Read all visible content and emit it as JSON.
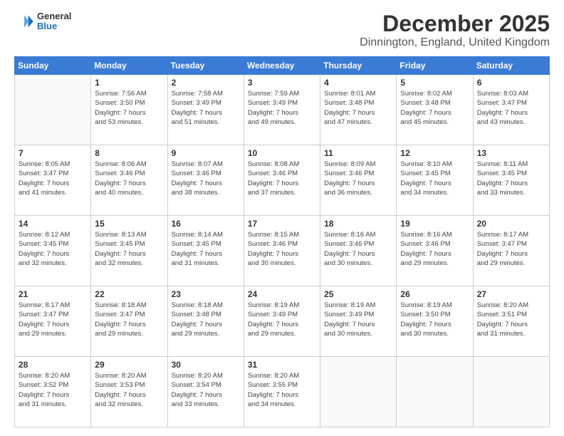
{
  "logo": {
    "general": "General",
    "blue": "Blue"
  },
  "header": {
    "month": "December 2025",
    "location": "Dinnington, England, United Kingdom"
  },
  "weekdays": [
    "Sunday",
    "Monday",
    "Tuesday",
    "Wednesday",
    "Thursday",
    "Friday",
    "Saturday"
  ],
  "weeks": [
    [
      {
        "day": "",
        "info": ""
      },
      {
        "day": "1",
        "info": "Sunrise: 7:56 AM\nSunset: 3:50 PM\nDaylight: 7 hours\nand 53 minutes."
      },
      {
        "day": "2",
        "info": "Sunrise: 7:58 AM\nSunset: 3:49 PM\nDaylight: 7 hours\nand 51 minutes."
      },
      {
        "day": "3",
        "info": "Sunrise: 7:59 AM\nSunset: 3:49 PM\nDaylight: 7 hours\nand 49 minutes."
      },
      {
        "day": "4",
        "info": "Sunrise: 8:01 AM\nSunset: 3:48 PM\nDaylight: 7 hours\nand 47 minutes."
      },
      {
        "day": "5",
        "info": "Sunrise: 8:02 AM\nSunset: 3:48 PM\nDaylight: 7 hours\nand 45 minutes."
      },
      {
        "day": "6",
        "info": "Sunrise: 8:03 AM\nSunset: 3:47 PM\nDaylight: 7 hours\nand 43 minutes."
      }
    ],
    [
      {
        "day": "7",
        "info": "Sunrise: 8:05 AM\nSunset: 3:47 PM\nDaylight: 7 hours\nand 41 minutes."
      },
      {
        "day": "8",
        "info": "Sunrise: 8:06 AM\nSunset: 3:46 PM\nDaylight: 7 hours\nand 40 minutes."
      },
      {
        "day": "9",
        "info": "Sunrise: 8:07 AM\nSunset: 3:46 PM\nDaylight: 7 hours\nand 38 minutes."
      },
      {
        "day": "10",
        "info": "Sunrise: 8:08 AM\nSunset: 3:46 PM\nDaylight: 7 hours\nand 37 minutes."
      },
      {
        "day": "11",
        "info": "Sunrise: 8:09 AM\nSunset: 3:46 PM\nDaylight: 7 hours\nand 36 minutes."
      },
      {
        "day": "12",
        "info": "Sunrise: 8:10 AM\nSunset: 3:45 PM\nDaylight: 7 hours\nand 34 minutes."
      },
      {
        "day": "13",
        "info": "Sunrise: 8:11 AM\nSunset: 3:45 PM\nDaylight: 7 hours\nand 33 minutes."
      }
    ],
    [
      {
        "day": "14",
        "info": "Sunrise: 8:12 AM\nSunset: 3:45 PM\nDaylight: 7 hours\nand 32 minutes."
      },
      {
        "day": "15",
        "info": "Sunrise: 8:13 AM\nSunset: 3:45 PM\nDaylight: 7 hours\nand 32 minutes."
      },
      {
        "day": "16",
        "info": "Sunrise: 8:14 AM\nSunset: 3:45 PM\nDaylight: 7 hours\nand 31 minutes."
      },
      {
        "day": "17",
        "info": "Sunrise: 8:15 AM\nSunset: 3:46 PM\nDaylight: 7 hours\nand 30 minutes."
      },
      {
        "day": "18",
        "info": "Sunrise: 8:16 AM\nSunset: 3:46 PM\nDaylight: 7 hours\nand 30 minutes."
      },
      {
        "day": "19",
        "info": "Sunrise: 8:16 AM\nSunset: 3:46 PM\nDaylight: 7 hours\nand 29 minutes."
      },
      {
        "day": "20",
        "info": "Sunrise: 8:17 AM\nSunset: 3:47 PM\nDaylight: 7 hours\nand 29 minutes."
      }
    ],
    [
      {
        "day": "21",
        "info": "Sunrise: 8:17 AM\nSunset: 3:47 PM\nDaylight: 7 hours\nand 29 minutes."
      },
      {
        "day": "22",
        "info": "Sunrise: 8:18 AM\nSunset: 3:47 PM\nDaylight: 7 hours\nand 29 minutes."
      },
      {
        "day": "23",
        "info": "Sunrise: 8:18 AM\nSunset: 3:48 PM\nDaylight: 7 hours\nand 29 minutes."
      },
      {
        "day": "24",
        "info": "Sunrise: 8:19 AM\nSunset: 3:49 PM\nDaylight: 7 hours\nand 29 minutes."
      },
      {
        "day": "25",
        "info": "Sunrise: 8:19 AM\nSunset: 3:49 PM\nDaylight: 7 hours\nand 30 minutes."
      },
      {
        "day": "26",
        "info": "Sunrise: 8:19 AM\nSunset: 3:50 PM\nDaylight: 7 hours\nand 30 minutes."
      },
      {
        "day": "27",
        "info": "Sunrise: 8:20 AM\nSunset: 3:51 PM\nDaylight: 7 hours\nand 31 minutes."
      }
    ],
    [
      {
        "day": "28",
        "info": "Sunrise: 8:20 AM\nSunset: 3:52 PM\nDaylight: 7 hours\nand 31 minutes."
      },
      {
        "day": "29",
        "info": "Sunrise: 8:20 AM\nSunset: 3:53 PM\nDaylight: 7 hours\nand 32 minutes."
      },
      {
        "day": "30",
        "info": "Sunrise: 8:20 AM\nSunset: 3:54 PM\nDaylight: 7 hours\nand 33 minutes."
      },
      {
        "day": "31",
        "info": "Sunrise: 8:20 AM\nSunset: 3:55 PM\nDaylight: 7 hours\nand 34 minutes."
      },
      {
        "day": "",
        "info": ""
      },
      {
        "day": "",
        "info": ""
      },
      {
        "day": "",
        "info": ""
      }
    ]
  ]
}
